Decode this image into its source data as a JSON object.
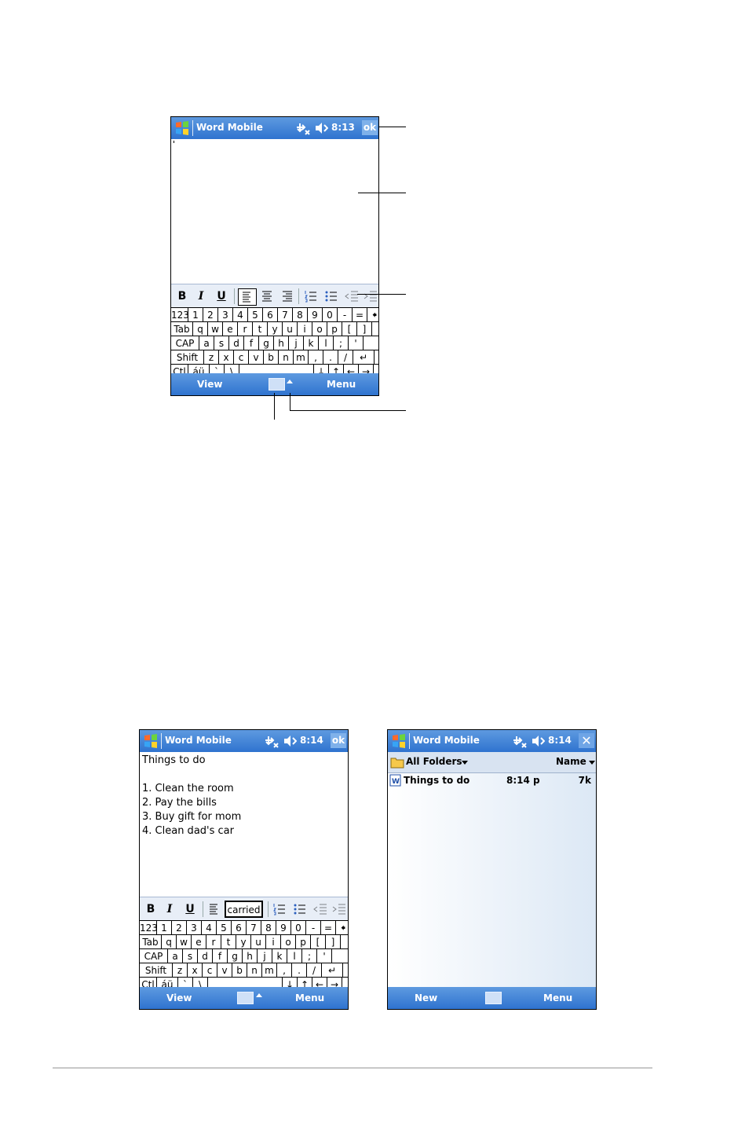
{
  "colors": {
    "title_bar": "#2f73cf",
    "accent": "#5e9ae0",
    "background": "#ffffff"
  },
  "screen1": {
    "app_title": "Word Mobile",
    "time": "8:13",
    "ok_label": "ok",
    "format": {
      "bold": "B",
      "italic": "I",
      "underline": "U"
    },
    "menu": {
      "left": "View",
      "right": "Menu"
    }
  },
  "screen2": {
    "app_title": "Word Mobile",
    "time": "8:14",
    "ok_label": "ok",
    "document_lines": [
      "Things to do",
      "",
      "1. Clean the room",
      "2. Pay the bills",
      "3. Buy gift for mom",
      "4. Clean dad's car"
    ],
    "format": {
      "bold": "B",
      "italic": "I",
      "underline": "U",
      "font_box": "carried"
    },
    "menu": {
      "left": "View",
      "right": "Menu"
    }
  },
  "screen3": {
    "app_title": "Word Mobile",
    "time": "8:14",
    "close_label": "✕",
    "folder_label": "All Folders",
    "sort_label": "Name",
    "files": [
      {
        "name": "Things to do",
        "time": "8:14 p",
        "size": "7k"
      }
    ],
    "menu": {
      "left": "New",
      "right": "Menu"
    }
  },
  "keyboard": {
    "rows": [
      [
        "123",
        "1",
        "2",
        "3",
        "4",
        "5",
        "6",
        "7",
        "8",
        "9",
        "0",
        "-",
        "=",
        "🠸"
      ],
      [
        "Tab",
        "q",
        "w",
        "e",
        "r",
        "t",
        "y",
        "u",
        "i",
        "o",
        "p",
        "[",
        "]"
      ],
      [
        "CAP",
        "a",
        "s",
        "d",
        "f",
        "g",
        "h",
        "j",
        "k",
        "l",
        ";",
        "'"
      ],
      [
        "Shift",
        "z",
        "x",
        "c",
        "v",
        "b",
        "n",
        "m",
        ",",
        ".",
        "/",
        "↵"
      ],
      [
        "Ctl",
        "áü",
        "`",
        "\\",
        "",
        "↓",
        "↑",
        "←",
        "→"
      ]
    ]
  }
}
